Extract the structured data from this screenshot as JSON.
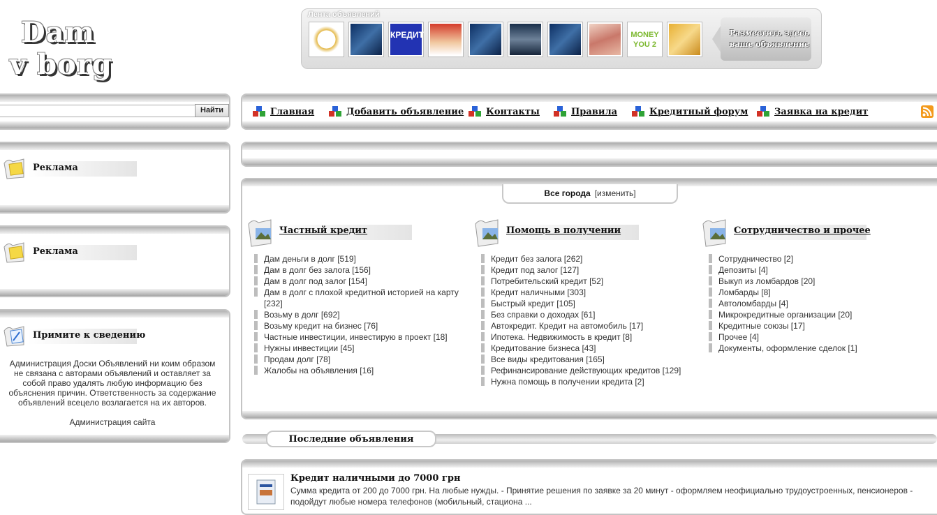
{
  "logo": {
    "line1": "Dam",
    "line2": "v borg"
  },
  "ad_strip": {
    "caption": "Лента объявлений",
    "post_ad_line1": "Разместить здесь",
    "post_ad_line2": "ваше объявление",
    "thumbnails": [
      "займы",
      "banner",
      "КРЕДИТ",
      "promo",
      "banner",
      "city",
      "banner",
      "money",
      "MONEY YOU 2",
      "cash"
    ]
  },
  "search": {
    "button_label": "Найти",
    "value": ""
  },
  "nav": {
    "items": [
      "Главная",
      "Добавить объявление",
      "Контакты",
      "Правила",
      "Кредитный форум",
      "Заявка на кредит"
    ]
  },
  "sidebar": {
    "ad_title_1": "Реклама",
    "ad_title_2": "Реклама",
    "notice_title": "Примите к сведению",
    "notice_text": "Администрация Доски Объявлений ни коим образом не связана с авторами объявлений и оставляет за собой право удалять любую информацию без объяснения причин. Ответственность за содержание объявлений всецело возлагается на их авторов.",
    "notice_sign": "Администрация сайта"
  },
  "city": {
    "label": "Все города",
    "change": "[изменить]"
  },
  "categories": [
    {
      "title": "Частный кредит",
      "items": [
        "Дам деньги в долг [519]",
        "Дам в долг без залога [156]",
        "Дам в долг под залог [154]",
        "Дам в долг с плохой кредитной историей на карту [232]",
        "Возьму в долг [692]",
        "Возьму кредит на бизнес [76]",
        "Частные инвестиции, инвестирую в проект [18]",
        "Нужны инвестиции [45]",
        "Продам долг [78]",
        "Жалобы на объявления [16]"
      ]
    },
    {
      "title": "Помощь в получении",
      "items": [
        "Кредит без залога [262]",
        "Кредит под залог [127]",
        "Потребительский кредит [52]",
        "Кредит наличными [303]",
        "Быстрый кредит [105]",
        "Без справки о доходах [61]",
        "Автокредит. Кредит на автомобиль [17]",
        "Ипотека. Недвижимость в кредит [8]",
        "Кредитование бизнеса [43]",
        "Все виды кредитования [165]",
        "Рефинансирование действующих кредитов [129]",
        "Нужна помощь в получении кредита [2]"
      ]
    },
    {
      "title": "Сотрудничество и прочее",
      "items": [
        "Сотрудничество [2]",
        "Депозиты [4]",
        "Выкуп из ломбардов [20]",
        "Ломбарды [8]",
        "Автоломбарды [4]",
        "Микрокредитные организации [20]",
        "Кредитные союзы [17]",
        "Прочее [4]",
        "Документы, оформление сделок [1]"
      ]
    }
  ],
  "latest": {
    "title": "Последние объявления",
    "listing": {
      "title": "Кредит наличными до 7000 грн",
      "text": "Сумма кредита от 200 до 7000 грн. На любые нужды. - Принятие решения по заявке за 20 минут - оформляем неофициально трудоустроенных, пенсионеров - подойдут любые номера телефонов (мобильный, стациона ..."
    }
  }
}
